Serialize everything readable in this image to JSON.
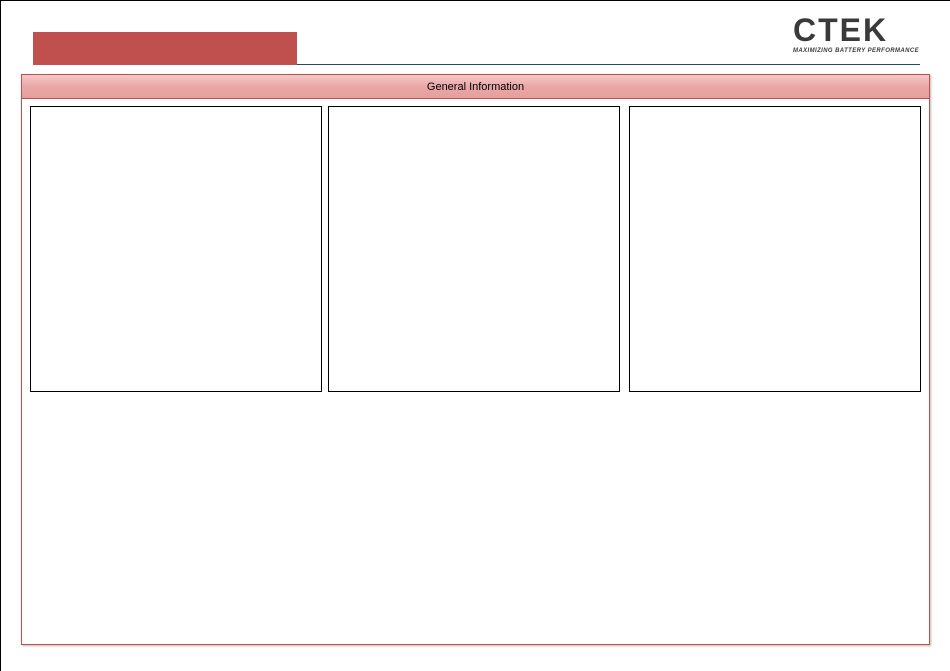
{
  "brand": {
    "logo_text": "CTEK",
    "tagline": "MAXIMIZING BATTERY PERFORMANCE",
    "accent_color": "#c0504d"
  },
  "section": {
    "title": "General Information"
  }
}
